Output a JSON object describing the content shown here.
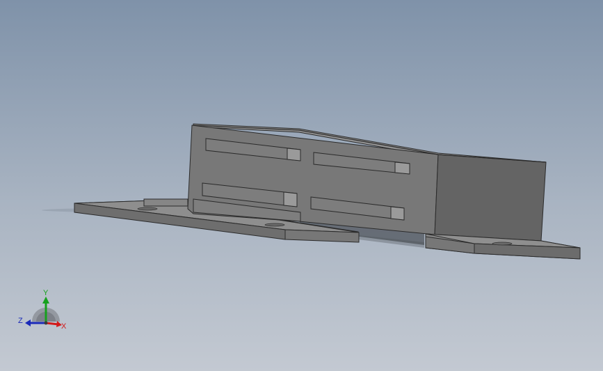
{
  "viewport": {
    "background_top": "#7f92a9",
    "background_bottom": "#c3c9d2"
  },
  "model": {
    "body_color": "#767676",
    "body_dark": "#5f5f5f",
    "top_color": "#909090",
    "slot_face": "#7c7c7c",
    "slot_end": "#9a9a9a",
    "plate_color": "#8a8a8a",
    "plate_edge": "#6a6a6a"
  },
  "triad": {
    "x_label": "X",
    "y_label": "Y",
    "z_label": "Z",
    "x_color": "#d21a1a",
    "y_color": "#16a11d",
    "z_color": "#1a2ab8"
  }
}
